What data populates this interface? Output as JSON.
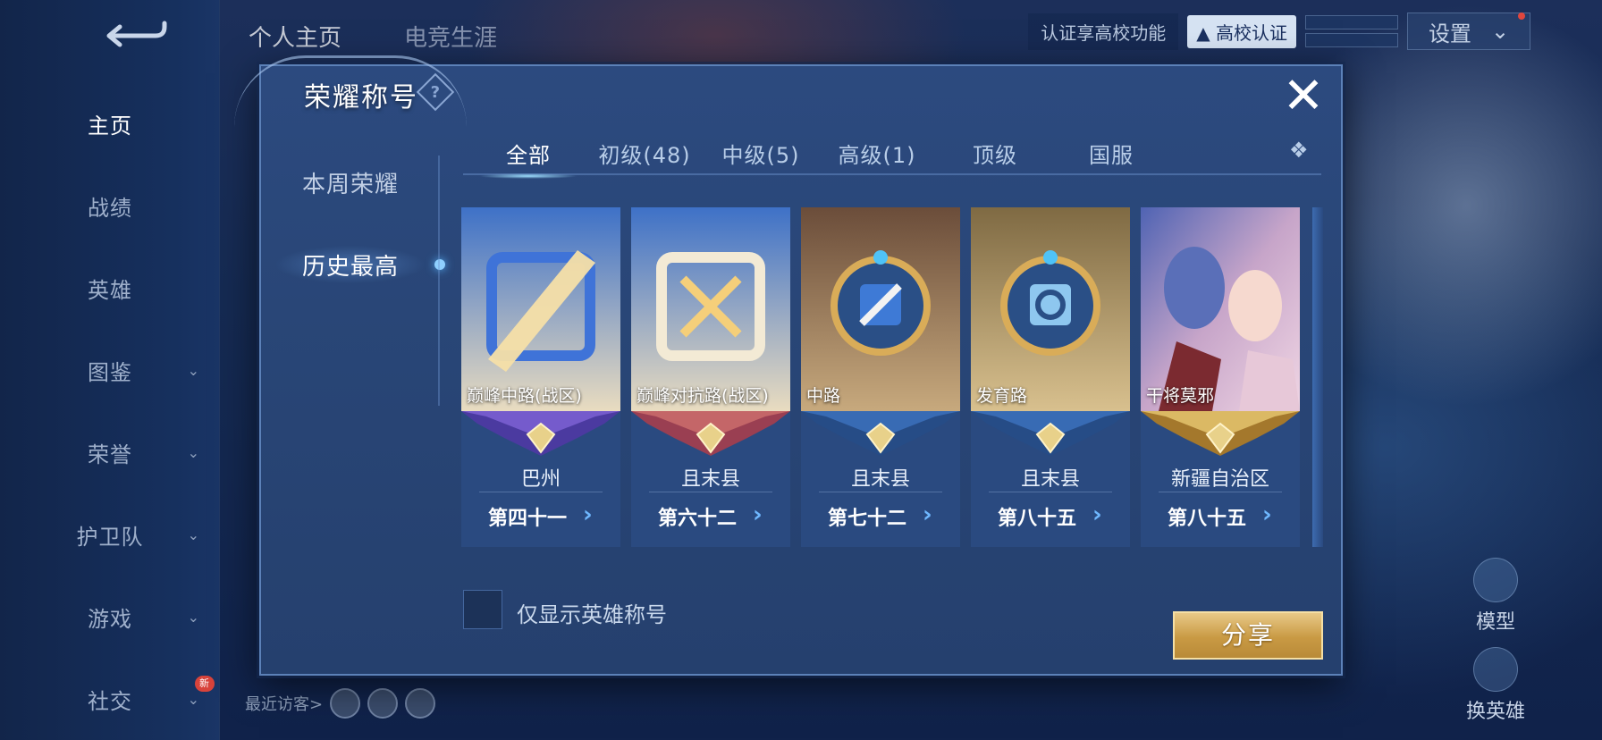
{
  "nav": {
    "items": [
      {
        "label": "主页",
        "active": true,
        "chevron": false
      },
      {
        "label": "战绩",
        "active": false,
        "chevron": false
      },
      {
        "label": "英雄",
        "active": false,
        "chevron": false
      },
      {
        "label": "图鉴",
        "active": false,
        "chevron": true
      },
      {
        "label": "荣誉",
        "active": false,
        "chevron": true
      },
      {
        "label": "护卫队",
        "active": false,
        "chevron": true
      },
      {
        "label": "游戏",
        "active": false,
        "chevron": true
      },
      {
        "label": "社交",
        "active": false,
        "chevron": true,
        "badge": "新"
      }
    ],
    "chevron_glyph": "⌄"
  },
  "header": {
    "tabs": [
      "个人主页",
      "电竞生涯"
    ],
    "cert_text": "认证享高校功能",
    "cert_button": "高校认证",
    "settings": "设置"
  },
  "footer": {
    "recent_visitors": "最近访客>",
    "model_label": "模型",
    "change_hero_label": "换英雄"
  },
  "dialog": {
    "title": "荣耀称号",
    "help_glyph": "?",
    "close_glyph": "✕",
    "side_tabs": [
      {
        "label": "本周荣耀",
        "active": false
      },
      {
        "label": "历史最高",
        "active": true
      }
    ],
    "category_tabs": [
      {
        "label": "全部",
        "active": true
      },
      {
        "label": "初级(48)",
        "active": false
      },
      {
        "label": "中级(5)",
        "active": false
      },
      {
        "label": "高级(1)",
        "active": false
      },
      {
        "label": "顶级",
        "active": false
      },
      {
        "label": "国服",
        "active": false
      }
    ],
    "category_more_glyph": "❖",
    "cards": [
      {
        "title": "巅峰中路(战区)",
        "region": "巴州",
        "rank": "第四十一",
        "art": "blue-frame",
        "banner": "purple"
      },
      {
        "title": "巅峰对抗路(战区)",
        "region": "且末县",
        "rank": "第六十二",
        "art": "blue-frame-x",
        "banner": "red"
      },
      {
        "title": "中路",
        "region": "且末县",
        "rank": "第七十二",
        "art": "brown-medal",
        "banner": "blue"
      },
      {
        "title": "发育路",
        "region": "且末县",
        "rank": "第八十五",
        "art": "gold-medal",
        "banner": "blue"
      },
      {
        "title": "干将莫邪",
        "region": "新疆自治区",
        "rank": "第八十五",
        "art": "hero-portrait",
        "banner": "gold"
      }
    ],
    "arrow_glyph": "›",
    "checkbox_label": "仅显示英雄称号",
    "share_button": "分享"
  },
  "colors": {
    "accent_blue": "#6fb8ff",
    "gold": "#c99a44",
    "dialog_bg": "#2a4778"
  }
}
